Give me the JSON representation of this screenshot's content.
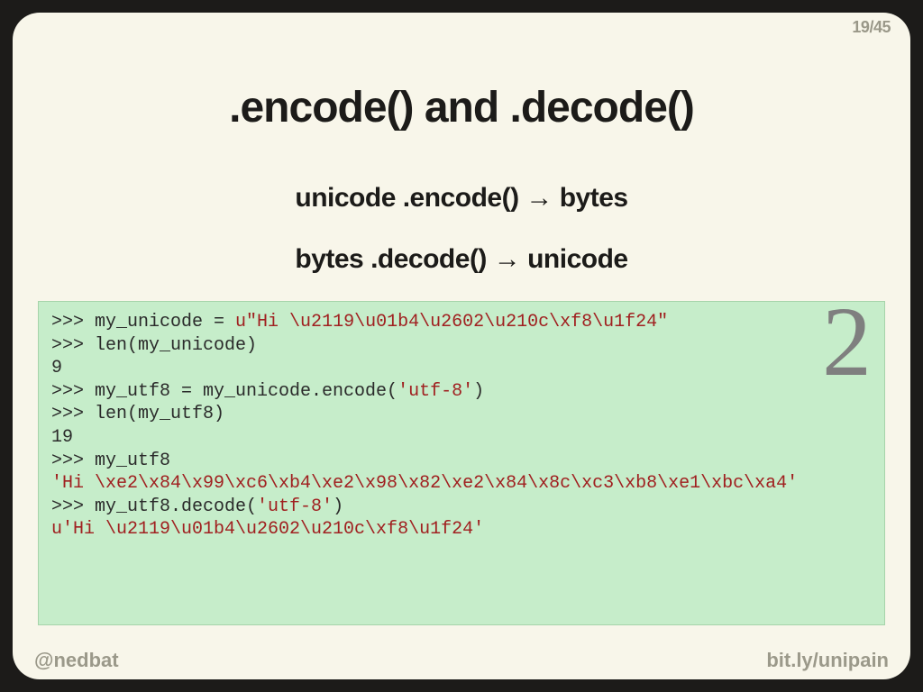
{
  "page": {
    "current": "19",
    "total": "45",
    "sep": "/"
  },
  "title": ".encode() and .decode()",
  "sub1": "unicode .encode() → bytes",
  "sub2": "bytes .decode() → unicode",
  "badge": "2",
  "code": {
    "l01_a": ">>> my_unicode = ",
    "l01_b": "u\"Hi \\u2119\\u01b4\\u2602\\u210c\\xf8\\u1f24\"",
    "l02": ">>> len(my_unicode)",
    "l03": "9",
    "l04": "",
    "l05_a": ">>> my_utf8 = my_unicode.encode(",
    "l05_b": "'utf-8'",
    "l05_c": ")",
    "l06": ">>> len(my_utf8)",
    "l07": "19",
    "l08": ">>> my_utf8",
    "l09": "'Hi \\xe2\\x84\\x99\\xc6\\xb4\\xe2\\x98\\x82\\xe2\\x84\\x8c\\xc3\\xb8\\xe1\\xbc\\xa4'",
    "l10": "",
    "l11_a": ">>> my_utf8.decode(",
    "l11_b": "'utf-8'",
    "l11_c": ")",
    "l12": "u'Hi \\u2119\\u01b4\\u2602\\u210c\\xf8\\u1f24'"
  },
  "footer": {
    "left": "@nedbat",
    "right": "bit.ly/unipain"
  }
}
